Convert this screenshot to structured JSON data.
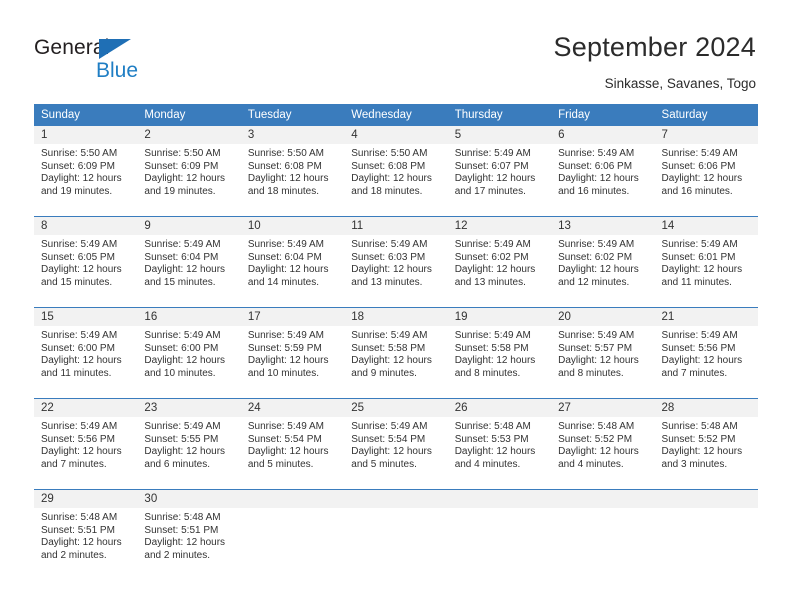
{
  "brand": {
    "name_part1": "General",
    "name_part2": "Blue",
    "accent_color": "#1f7ec4",
    "triangle_color": "#1f6fb5"
  },
  "header": {
    "title": "September 2024",
    "subtitle": "Sinkasse, Savanes, Togo",
    "header_bg": "#3a7cbd"
  },
  "weekdays": [
    "Sunday",
    "Monday",
    "Tuesday",
    "Wednesday",
    "Thursday",
    "Friday",
    "Saturday"
  ],
  "weeks": [
    [
      {
        "day": "1",
        "sunrise": "Sunrise: 5:50 AM",
        "sunset": "Sunset: 6:09 PM",
        "daylight1": "Daylight: 12 hours",
        "daylight2": "and 19 minutes."
      },
      {
        "day": "2",
        "sunrise": "Sunrise: 5:50 AM",
        "sunset": "Sunset: 6:09 PM",
        "daylight1": "Daylight: 12 hours",
        "daylight2": "and 19 minutes."
      },
      {
        "day": "3",
        "sunrise": "Sunrise: 5:50 AM",
        "sunset": "Sunset: 6:08 PM",
        "daylight1": "Daylight: 12 hours",
        "daylight2": "and 18 minutes."
      },
      {
        "day": "4",
        "sunrise": "Sunrise: 5:50 AM",
        "sunset": "Sunset: 6:08 PM",
        "daylight1": "Daylight: 12 hours",
        "daylight2": "and 18 minutes."
      },
      {
        "day": "5",
        "sunrise": "Sunrise: 5:49 AM",
        "sunset": "Sunset: 6:07 PM",
        "daylight1": "Daylight: 12 hours",
        "daylight2": "and 17 minutes."
      },
      {
        "day": "6",
        "sunrise": "Sunrise: 5:49 AM",
        "sunset": "Sunset: 6:06 PM",
        "daylight1": "Daylight: 12 hours",
        "daylight2": "and 16 minutes."
      },
      {
        "day": "7",
        "sunrise": "Sunrise: 5:49 AM",
        "sunset": "Sunset: 6:06 PM",
        "daylight1": "Daylight: 12 hours",
        "daylight2": "and 16 minutes."
      }
    ],
    [
      {
        "day": "8",
        "sunrise": "Sunrise: 5:49 AM",
        "sunset": "Sunset: 6:05 PM",
        "daylight1": "Daylight: 12 hours",
        "daylight2": "and 15 minutes."
      },
      {
        "day": "9",
        "sunrise": "Sunrise: 5:49 AM",
        "sunset": "Sunset: 6:04 PM",
        "daylight1": "Daylight: 12 hours",
        "daylight2": "and 15 minutes."
      },
      {
        "day": "10",
        "sunrise": "Sunrise: 5:49 AM",
        "sunset": "Sunset: 6:04 PM",
        "daylight1": "Daylight: 12 hours",
        "daylight2": "and 14 minutes."
      },
      {
        "day": "11",
        "sunrise": "Sunrise: 5:49 AM",
        "sunset": "Sunset: 6:03 PM",
        "daylight1": "Daylight: 12 hours",
        "daylight2": "and 13 minutes."
      },
      {
        "day": "12",
        "sunrise": "Sunrise: 5:49 AM",
        "sunset": "Sunset: 6:02 PM",
        "daylight1": "Daylight: 12 hours",
        "daylight2": "and 13 minutes."
      },
      {
        "day": "13",
        "sunrise": "Sunrise: 5:49 AM",
        "sunset": "Sunset: 6:02 PM",
        "daylight1": "Daylight: 12 hours",
        "daylight2": "and 12 minutes."
      },
      {
        "day": "14",
        "sunrise": "Sunrise: 5:49 AM",
        "sunset": "Sunset: 6:01 PM",
        "daylight1": "Daylight: 12 hours",
        "daylight2": "and 11 minutes."
      }
    ],
    [
      {
        "day": "15",
        "sunrise": "Sunrise: 5:49 AM",
        "sunset": "Sunset: 6:00 PM",
        "daylight1": "Daylight: 12 hours",
        "daylight2": "and 11 minutes."
      },
      {
        "day": "16",
        "sunrise": "Sunrise: 5:49 AM",
        "sunset": "Sunset: 6:00 PM",
        "daylight1": "Daylight: 12 hours",
        "daylight2": "and 10 minutes."
      },
      {
        "day": "17",
        "sunrise": "Sunrise: 5:49 AM",
        "sunset": "Sunset: 5:59 PM",
        "daylight1": "Daylight: 12 hours",
        "daylight2": "and 10 minutes."
      },
      {
        "day": "18",
        "sunrise": "Sunrise: 5:49 AM",
        "sunset": "Sunset: 5:58 PM",
        "daylight1": "Daylight: 12 hours",
        "daylight2": "and 9 minutes."
      },
      {
        "day": "19",
        "sunrise": "Sunrise: 5:49 AM",
        "sunset": "Sunset: 5:58 PM",
        "daylight1": "Daylight: 12 hours",
        "daylight2": "and 8 minutes."
      },
      {
        "day": "20",
        "sunrise": "Sunrise: 5:49 AM",
        "sunset": "Sunset: 5:57 PM",
        "daylight1": "Daylight: 12 hours",
        "daylight2": "and 8 minutes."
      },
      {
        "day": "21",
        "sunrise": "Sunrise: 5:49 AM",
        "sunset": "Sunset: 5:56 PM",
        "daylight1": "Daylight: 12 hours",
        "daylight2": "and 7 minutes."
      }
    ],
    [
      {
        "day": "22",
        "sunrise": "Sunrise: 5:49 AM",
        "sunset": "Sunset: 5:56 PM",
        "daylight1": "Daylight: 12 hours",
        "daylight2": "and 7 minutes."
      },
      {
        "day": "23",
        "sunrise": "Sunrise: 5:49 AM",
        "sunset": "Sunset: 5:55 PM",
        "daylight1": "Daylight: 12 hours",
        "daylight2": "and 6 minutes."
      },
      {
        "day": "24",
        "sunrise": "Sunrise: 5:49 AM",
        "sunset": "Sunset: 5:54 PM",
        "daylight1": "Daylight: 12 hours",
        "daylight2": "and 5 minutes."
      },
      {
        "day": "25",
        "sunrise": "Sunrise: 5:49 AM",
        "sunset": "Sunset: 5:54 PM",
        "daylight1": "Daylight: 12 hours",
        "daylight2": "and 5 minutes."
      },
      {
        "day": "26",
        "sunrise": "Sunrise: 5:48 AM",
        "sunset": "Sunset: 5:53 PM",
        "daylight1": "Daylight: 12 hours",
        "daylight2": "and 4 minutes."
      },
      {
        "day": "27",
        "sunrise": "Sunrise: 5:48 AM",
        "sunset": "Sunset: 5:52 PM",
        "daylight1": "Daylight: 12 hours",
        "daylight2": "and 4 minutes."
      },
      {
        "day": "28",
        "sunrise": "Sunrise: 5:48 AM",
        "sunset": "Sunset: 5:52 PM",
        "daylight1": "Daylight: 12 hours",
        "daylight2": "and 3 minutes."
      }
    ],
    [
      {
        "day": "29",
        "sunrise": "Sunrise: 5:48 AM",
        "sunset": "Sunset: 5:51 PM",
        "daylight1": "Daylight: 12 hours",
        "daylight2": "and 2 minutes."
      },
      {
        "day": "30",
        "sunrise": "Sunrise: 5:48 AM",
        "sunset": "Sunset: 5:51 PM",
        "daylight1": "Daylight: 12 hours",
        "daylight2": "and 2 minutes."
      },
      {
        "day": "",
        "sunrise": "",
        "sunset": "",
        "daylight1": "",
        "daylight2": ""
      },
      {
        "day": "",
        "sunrise": "",
        "sunset": "",
        "daylight1": "",
        "daylight2": ""
      },
      {
        "day": "",
        "sunrise": "",
        "sunset": "",
        "daylight1": "",
        "daylight2": ""
      },
      {
        "day": "",
        "sunrise": "",
        "sunset": "",
        "daylight1": "",
        "daylight2": ""
      },
      {
        "day": "",
        "sunrise": "",
        "sunset": "",
        "daylight1": "",
        "daylight2": ""
      }
    ]
  ]
}
